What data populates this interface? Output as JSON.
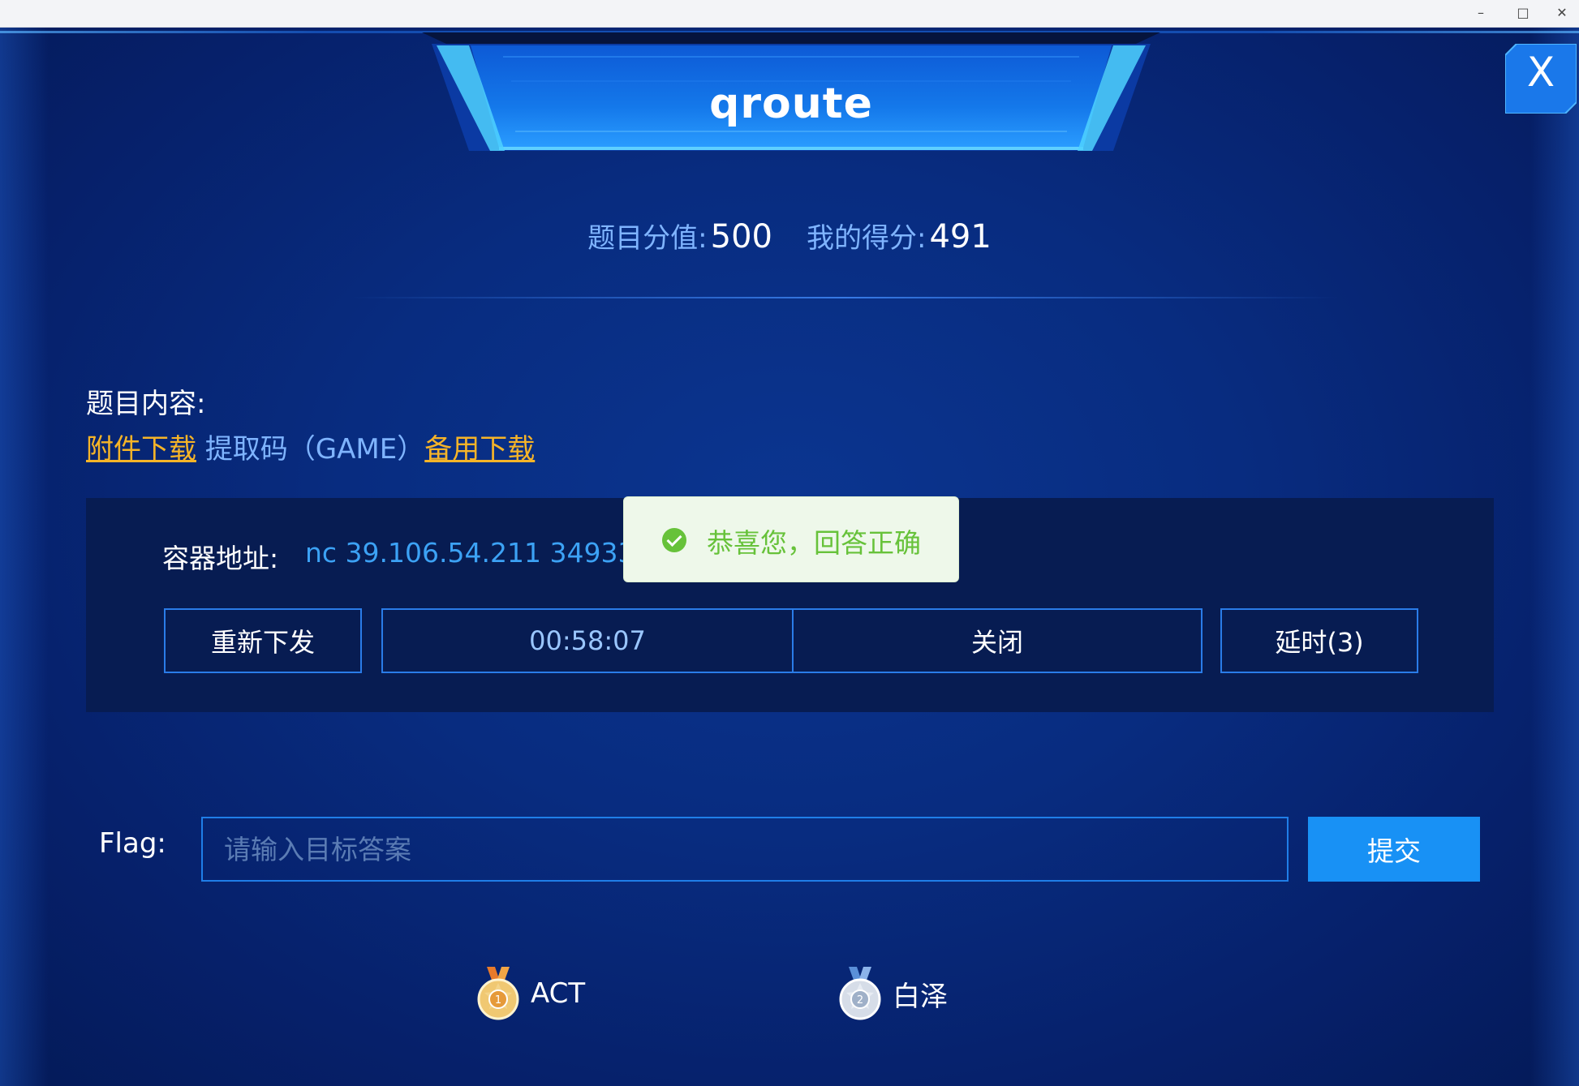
{
  "window": {
    "minimize_icon": "minimize-icon",
    "maximize_icon": "maximize-icon",
    "close_icon": "close-icon"
  },
  "header": {
    "title": "qroute",
    "close_label": "X"
  },
  "score": {
    "value_label": "题目分值:",
    "value": "500",
    "my_label": "我的得分:",
    "my_value": "491"
  },
  "content": {
    "heading": "题目内容:",
    "attachment_link": "附件下载",
    "code_text": "提取码（GAME）",
    "backup_link": "备用下载"
  },
  "container": {
    "label": "容器地址:",
    "address": "nc 39.106.54.211 34933",
    "reissue_label": "重新下发",
    "timer": "00:58:07",
    "close_label": "关闭",
    "extend_label": "延时(3)"
  },
  "toast": {
    "message": "恭喜您，回答正确",
    "icon": "check-circle-icon",
    "color": "#67c23a"
  },
  "flag": {
    "label": "Flag:",
    "placeholder": "请输入目标答案",
    "value": "",
    "submit_label": "提交"
  },
  "solvers": [
    {
      "rank": "1",
      "name": "ACT",
      "icon": "gold-medal-icon"
    },
    {
      "rank": "2",
      "name": "白泽",
      "icon": "silver-medal-icon"
    }
  ],
  "colors": {
    "accent": "#1891f5",
    "link": "#f6b428",
    "address": "#3ca2f5",
    "background": "#0a2a78"
  }
}
